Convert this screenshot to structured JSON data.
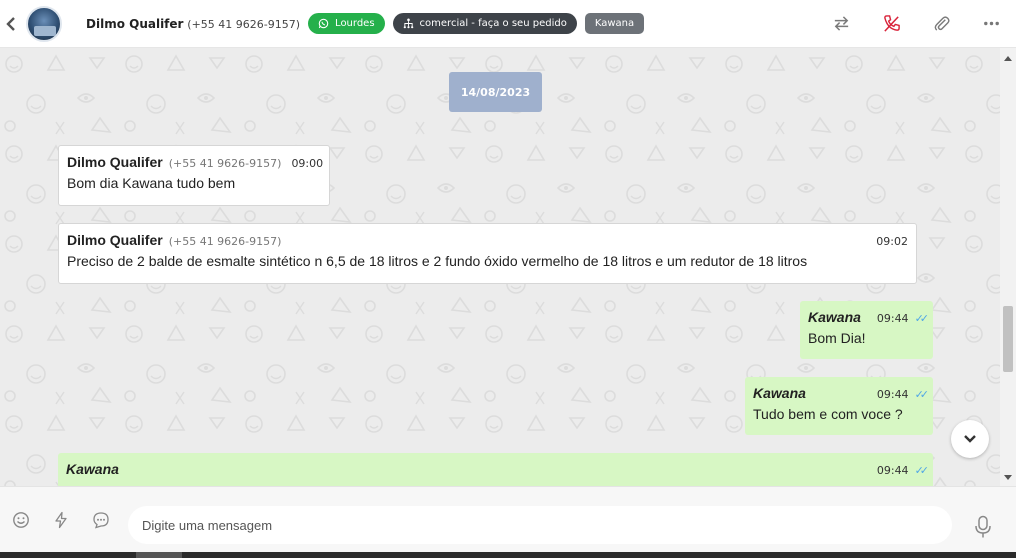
{
  "header": {
    "contact_name": "Dilmo Qualifer",
    "contact_phone": "(+55 41 9626-9157)",
    "tags": [
      {
        "label": "Lourdes",
        "color": "#25b04b",
        "icon": "whatsapp-icon"
      },
      {
        "label": "comercial - faça o seu pedido",
        "color": "#3e4349",
        "icon": "sitemap-icon"
      },
      {
        "label": "Kawana",
        "color": "#6d7278"
      }
    ],
    "actions": [
      "transfer-icon",
      "end-call-icon",
      "attach-icon",
      "more-icon"
    ]
  },
  "chat": {
    "date": "14/08/2023",
    "messages": [
      {
        "direction": "in",
        "sender": "Dilmo Qualifer",
        "phone": "(+55 41 9626-9157)",
        "time": "09:00",
        "text": "Bom dia Kawana tudo bem"
      },
      {
        "direction": "in",
        "sender": "Dilmo Qualifer",
        "phone": "(+55 41 9626-9157)",
        "time": "09:02",
        "text": "Preciso de 2 balde de esmalte sintético n 6,5 de 18 litros e 2 fundo óxido vermelho de 18 litros e um redutor de 18 litros"
      },
      {
        "direction": "out",
        "sender": "Kawana",
        "time": "09:44",
        "ticks": "✓✓",
        "text": "Bom Dia!"
      },
      {
        "direction": "out",
        "sender": "Kawana",
        "time": "09:44",
        "ticks": "✓✓",
        "text": "Tudo bem e com voce ?"
      },
      {
        "direction": "out",
        "sender": "Kawana",
        "time": "09:44",
        "ticks": "✓✓",
        "text": ""
      }
    ],
    "colors": {
      "outgoing": "#d7f7c4",
      "incoming": "#ffffff",
      "date_pill": "#9fb0cd",
      "ticks": "#4fa6e6"
    }
  },
  "composer": {
    "placeholder": "Digite uma mensagem",
    "icons": [
      "emoji-icon",
      "quick-reply-icon",
      "message-template-icon",
      "microphone-icon"
    ]
  }
}
